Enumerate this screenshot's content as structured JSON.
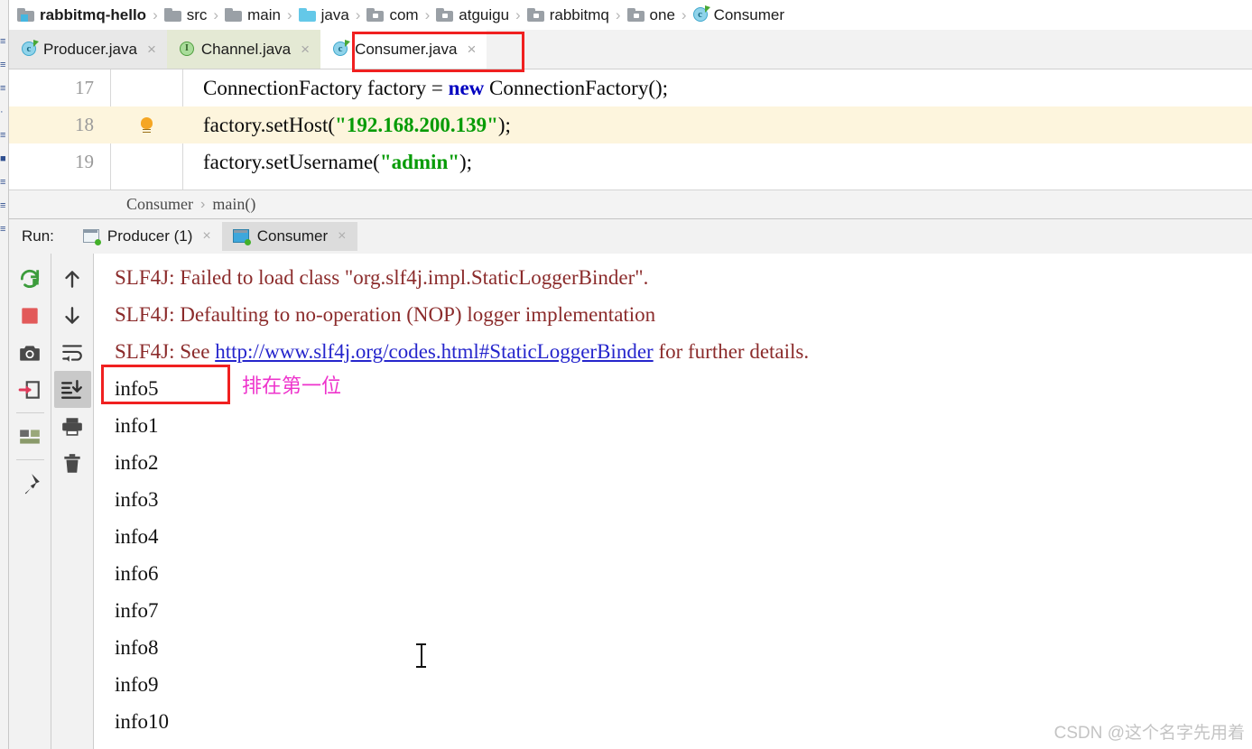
{
  "breadcrumb": {
    "items": [
      {
        "label": "rabbitmq-hello",
        "icon": "project-folder-icon",
        "kind": "project"
      },
      {
        "label": "src",
        "icon": "folder-icon",
        "kind": "folder"
      },
      {
        "label": "main",
        "icon": "folder-icon",
        "kind": "folder"
      },
      {
        "label": "java",
        "icon": "source-folder-icon",
        "kind": "source"
      },
      {
        "label": "com",
        "icon": "package-folder-icon",
        "kind": "package"
      },
      {
        "label": "atguigu",
        "icon": "package-folder-icon",
        "kind": "package"
      },
      {
        "label": "rabbitmq",
        "icon": "package-folder-icon",
        "kind": "package"
      },
      {
        "label": "one",
        "icon": "package-folder-icon",
        "kind": "package"
      },
      {
        "label": "Consumer",
        "icon": "java-class-icon",
        "kind": "class"
      }
    ],
    "separator": "›"
  },
  "editor_tabs": {
    "close_glyph": "×",
    "tabs": [
      {
        "label": "Producer.java",
        "icon": "java-class-icon",
        "state": "inactive"
      },
      {
        "label": "Channel.java",
        "icon": "java-interface-icon",
        "state": "modified"
      },
      {
        "label": "Consumer.java",
        "icon": "java-class-icon",
        "state": "active"
      }
    ]
  },
  "editor": {
    "lines": [
      {
        "number": "17",
        "highlighted": false,
        "has_bulb": false,
        "segments": [
          {
            "t": "    ConnectionFactory factory = ",
            "c": "plain"
          },
          {
            "t": "new",
            "c": "keyword"
          },
          {
            "t": " ConnectionFactory();",
            "c": "plain"
          }
        ]
      },
      {
        "number": "18",
        "highlighted": true,
        "has_bulb": true,
        "segments": [
          {
            "t": "    factory.setHost(",
            "c": "plain"
          },
          {
            "t": "\"192.168.200.139\"",
            "c": "string"
          },
          {
            "t": ");",
            "c": "plain"
          }
        ]
      },
      {
        "number": "19",
        "highlighted": false,
        "has_bulb": false,
        "segments": [
          {
            "t": "    factory.setUsername(",
            "c": "plain"
          },
          {
            "t": "\"admin\"",
            "c": "string"
          },
          {
            "t": ");",
            "c": "plain"
          }
        ]
      }
    ]
  },
  "method_breadcrumb": {
    "class": "Consumer",
    "separator": "›",
    "method": "main()"
  },
  "run_panel": {
    "label": "Run:",
    "close_glyph": "×",
    "tabs": [
      {
        "label": "Producer (1)",
        "icon": "console-icon",
        "selected": false
      },
      {
        "label": "Consumer",
        "icon": "console-icon",
        "selected": true
      }
    ]
  },
  "toolbar_left": {
    "buttons": [
      {
        "name": "rerun-icon",
        "title": "Rerun",
        "selected": false
      },
      {
        "name": "stop-icon",
        "title": "Stop",
        "selected": false
      },
      {
        "name": "camera-icon",
        "title": "Screenshot",
        "selected": false
      },
      {
        "name": "export-icon",
        "title": "Export",
        "selected": false
      },
      {
        "name": "layout-icon",
        "title": "Layout Settings",
        "selected": false
      },
      {
        "name": "pin-icon",
        "title": "Pin Tab",
        "selected": false
      }
    ]
  },
  "toolbar_right": {
    "buttons": [
      {
        "name": "arrow-up-icon",
        "title": "Up the Stack Trace",
        "selected": false
      },
      {
        "name": "arrow-down-icon",
        "title": "Down the Stack Trace",
        "selected": false
      },
      {
        "name": "soft-wrap-icon",
        "title": "Use Soft Wraps",
        "selected": false
      },
      {
        "name": "scroll-to-end-icon",
        "title": "Scroll to End",
        "selected": true
      },
      {
        "name": "print-icon",
        "title": "Print",
        "selected": false
      },
      {
        "name": "trash-icon",
        "title": "Clear All",
        "selected": false
      }
    ]
  },
  "console": {
    "log_lines": [
      {
        "kind": "warn",
        "parts": [
          {
            "t": "SLF4J: Failed to load class \"org.slf4j.impl.StaticLoggerBinder\".",
            "link": false
          }
        ]
      },
      {
        "kind": "warn",
        "parts": [
          {
            "t": "SLF4J: Defaulting to no-operation (NOP) logger implementation",
            "link": false
          }
        ]
      },
      {
        "kind": "warn",
        "parts": [
          {
            "t": "SLF4J: See ",
            "link": false
          },
          {
            "t": "http://www.slf4j.org/codes.html#StaticLoggerBinder",
            "link": true
          },
          {
            "t": " for further details.",
            "link": false
          }
        ]
      }
    ],
    "messages": [
      "info5",
      "info1",
      "info2",
      "info3",
      "info4",
      "info6",
      "info7",
      "info8",
      "info9",
      "info10"
    ]
  },
  "annotations": {
    "chinese_note": "排在第一位",
    "highlight_color": "#f02020",
    "note_color": "#ee33cc"
  },
  "watermark": {
    "text": "CSDN @这个名字先用着"
  },
  "left_edge_strip": {
    "fragments": [
      "≡",
      "≡",
      "≡",
      "·",
      "≡",
      "■",
      "≡",
      "≡",
      "≡"
    ]
  }
}
